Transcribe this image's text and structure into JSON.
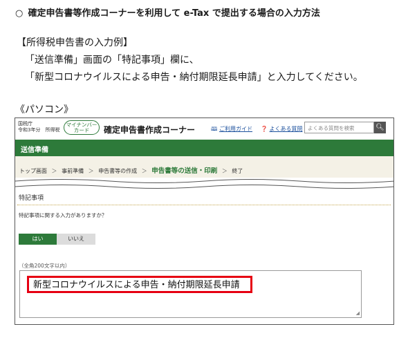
{
  "heading": {
    "mark": "○",
    "text": "確定申告書等作成コーナーを利用して e-Tax で提出する場合の入力方法"
  },
  "example": {
    "label": "【所得税申告書の入力例】",
    "line1": "「送信準備」画面の「特記事項」欄に、",
    "line2": "「新型コロナウイルスによる申告・納付期限延長申請」と入力してください。"
  },
  "pc_label": "《パソコン》",
  "screen": {
    "agency_line1": "国税庁",
    "agency_line2": "令和3年分　所得税",
    "mynumber_line1": "マイナンバー",
    "mynumber_line2": "カード",
    "corner_title": "確定申告書作成コーナー",
    "guide_icon": "book-icon",
    "guide_label": "ご利用ガイド",
    "faq_icon": "question-circle-icon",
    "faq_label": "よくある質問",
    "search_placeholder": "よくある質問を検索",
    "search_icon": "magnifier-icon",
    "page_title": "送信準備",
    "breadcrumbs": [
      "トップ画面",
      "事前準備",
      "申告書等の作成",
      "申告書等の送信・印刷",
      "終了"
    ],
    "crumb_separator": "＞",
    "section_title": "特記事項",
    "question": "特記事項に関する入力がありますか？",
    "yes_label": "はい",
    "no_label": "いいえ",
    "char_limit": "（全角200文字以内）",
    "input_value": "新型コロナウイルスによる申告・納付期限延長申請"
  },
  "colors": {
    "accent_green": "#2d7a3a",
    "highlight_red": "#e60012",
    "crumb_bg": "#f4f1e6"
  }
}
